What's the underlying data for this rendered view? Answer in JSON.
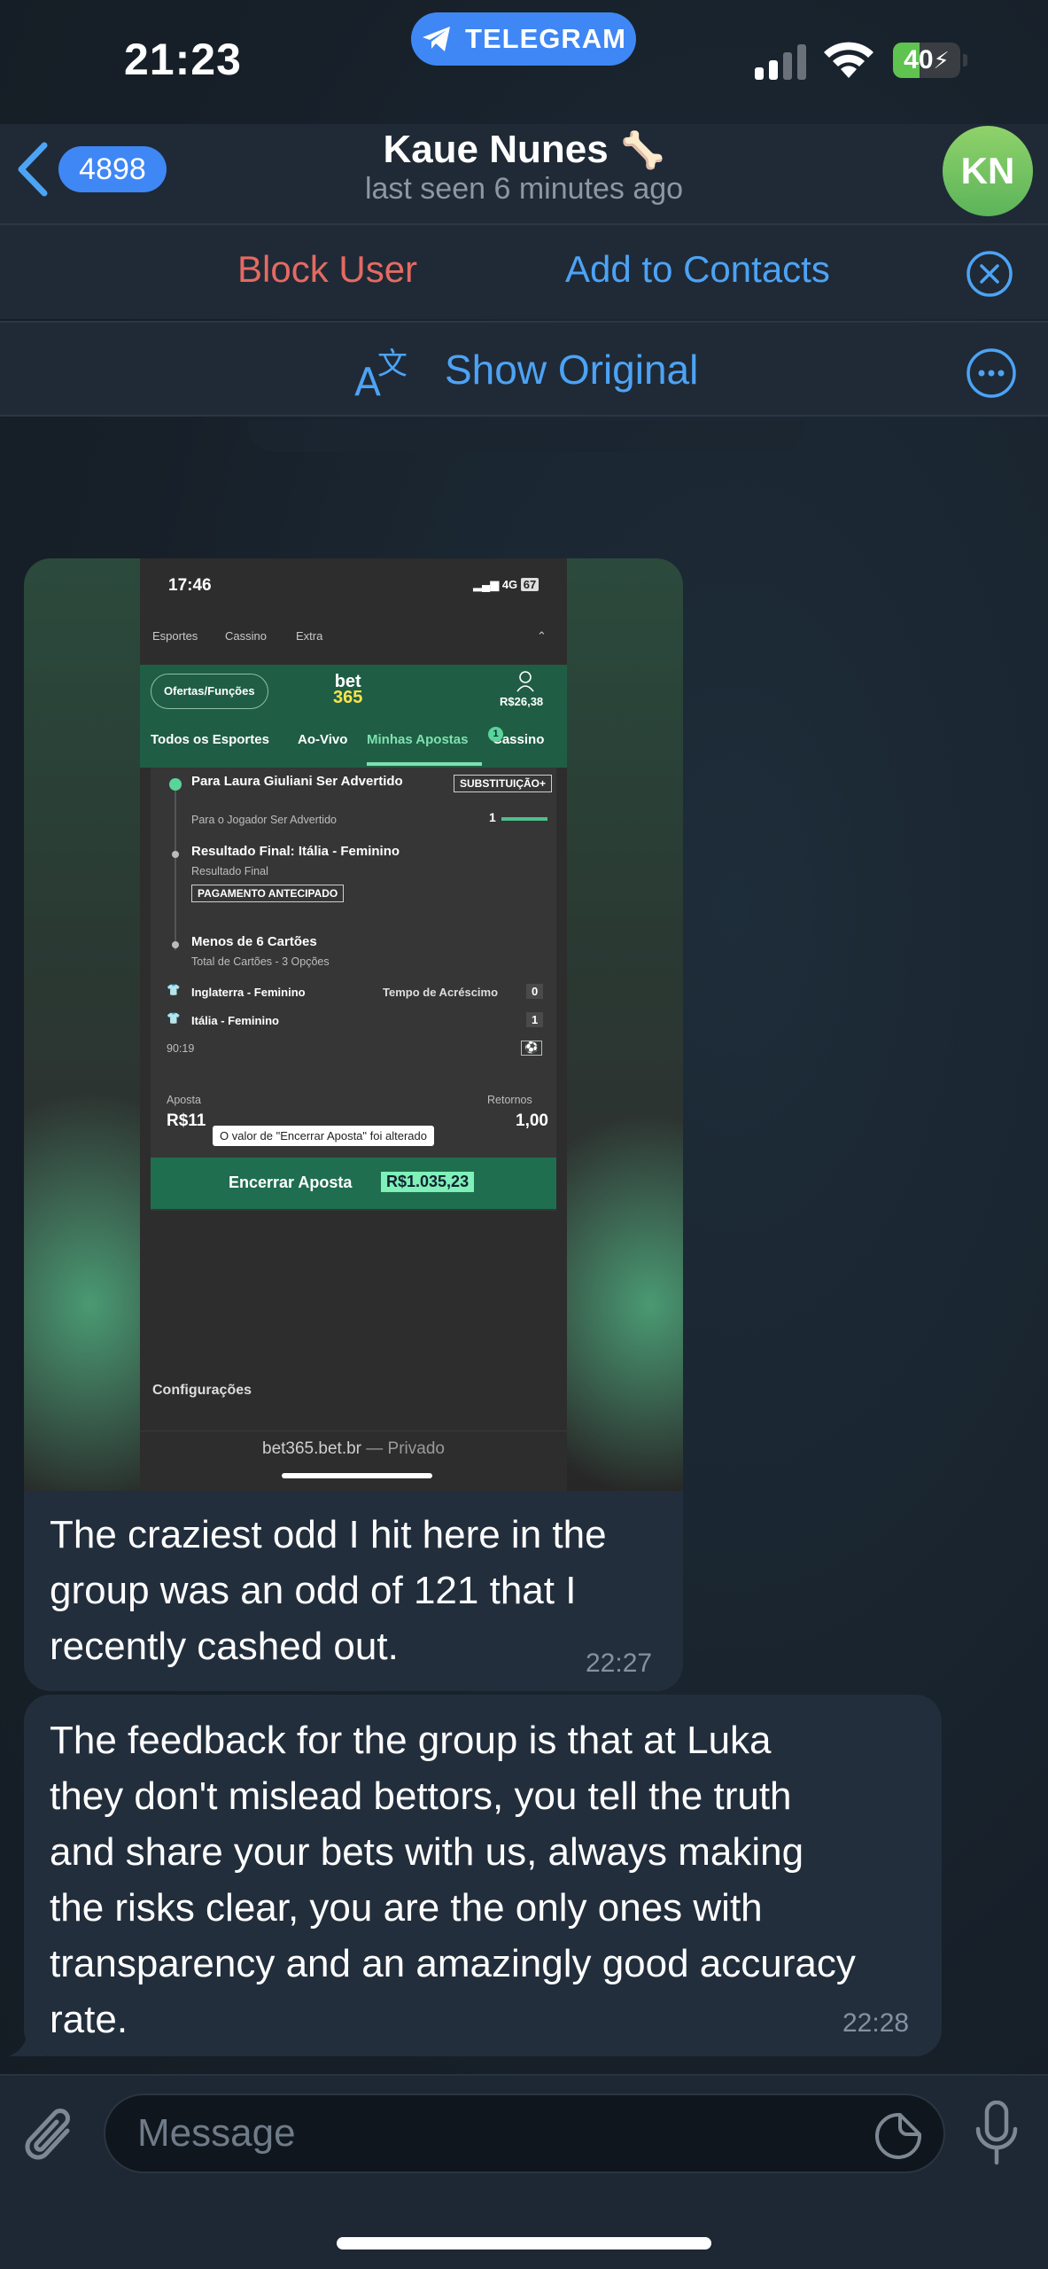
{
  "status_bar": {
    "time": "21:23",
    "pill_label": "TELEGRAM",
    "battery_level": "40",
    "battery_fraction": 0.4
  },
  "header": {
    "unread_count": "4898",
    "contact_name": "Kaue Nunes",
    "name_emoji": "🦴",
    "last_seen": "last seen 6 minutes ago",
    "avatar_initials": "KN"
  },
  "actions": {
    "block_user": "Block User",
    "add_to_contacts": "Add to Contacts",
    "show_original": "Show Original"
  },
  "screenshot": {
    "time": "17:46",
    "signal": "4G",
    "battery": "67",
    "nav": [
      "Esportes",
      "Cassino",
      "Extra"
    ],
    "ofertas": "Ofertas/Funções",
    "logo_top": "bet",
    "logo_bottom": "365",
    "balance": "R$26,38",
    "tabs": [
      "Todos os Esportes",
      "Ao-Vivo",
      "Minhas Apostas",
      "Cassino"
    ],
    "tab_badge": "1",
    "sel1_title": "Para Laura Giuliani Ser Advertido",
    "sel1_sub": "Para o Jogador Ser Advertido",
    "sel1_tag": "SUBSTITUIÇÃO+",
    "sel1_value": "1",
    "sel2_title": "Resultado Final: Itália - Feminino",
    "sel2_sub": "Resultado Final",
    "sel2_tag": "PAGAMENTO ANTECIPADO",
    "sel3_title": "Menos de 6 Cartões",
    "sel3_sub": "Total de Cartões - 3 Opções",
    "team1": "Inglaterra - Feminino",
    "team1_label": "Tempo de Acréscimo",
    "team1_score": "0",
    "team2": "Itália - Feminino",
    "team2_score": "1",
    "clock": "90:19",
    "aposta_label": "Aposta",
    "retornos_label": "Retornos",
    "aposta_value": "R$11",
    "retornos_value": "1,00",
    "tooltip": "O valor de \"Encerrar Aposta\" foi alterado",
    "cashout_label": "Encerrar Aposta",
    "cashout_amount": "R$1.035,23",
    "config": "Configurações",
    "url": "bet365.bet.br",
    "url_suffix": " — Privado"
  },
  "messages": [
    {
      "text_lines": [
        "The craziest odd I hit here in the",
        "group was an odd of 121 that I",
        "recently cashed out."
      ],
      "time": "22:27"
    },
    {
      "text_lines": [
        "The feedback for the group is that at Luka",
        "they don't mislead bettors, you tell the truth",
        "and share your bets with us, always making",
        "the risks clear, you are the only ones with",
        "transparency and an amazingly good accuracy",
        "rate."
      ],
      "time": "22:28"
    }
  ],
  "composer": {
    "placeholder": "Message"
  },
  "colors": {
    "accent": "#3f87f5",
    "link": "#4da3f5",
    "danger": "#e56a62",
    "bubble": "#222e3c"
  }
}
